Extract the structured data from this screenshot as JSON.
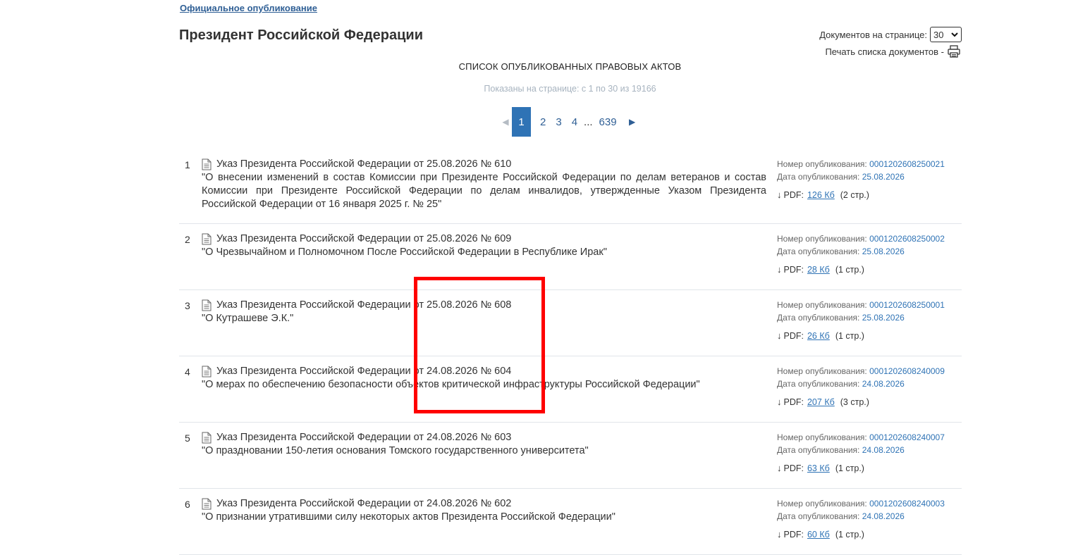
{
  "breadcrumb": "Официальное опубликование",
  "page_title": "Президент Российской Федерации",
  "per_page": {
    "label": "Документов на странице:",
    "value": "30"
  },
  "print_label": "Печать списка документов -",
  "list_heading": "СПИСОК ОПУБЛИКОВАННЫХ ПРАВОВЫХ АКТОВ",
  "shown_info": "Показаны на странице: с 1 по 30 из 19166",
  "pager": {
    "current": "1",
    "pages": [
      "2",
      "3",
      "4"
    ],
    "dots": "...",
    "last": "639"
  },
  "meta_labels": {
    "number": "Номер опубликования:",
    "date": "Дата опубликования:",
    "pdf": "PDF:"
  },
  "documents": [
    {
      "num": "1",
      "title": "Указ Президента Российской Федерации от 25.08.2026 № 610",
      "description": "\"О внесении изменений в состав Комиссии при Президенте Российской Федерации по делам ветеранов и состав Комиссии при Президенте Российской Федерации по делам инвалидов, утвержденные Указом Президента Российской Федерации от 16 января 2025 г. № 25\"",
      "pub_number": "0001202608250021",
      "pub_date": "25.08.2026",
      "pdf_size": "126 Кб",
      "pages": "(2 стр.)"
    },
    {
      "num": "2",
      "title": "Указ Президента Российской Федерации от 25.08.2026 № 609",
      "description": "\"О Чрезвычайном и Полномочном После Российской Федерации в Республике Ирак\"",
      "pub_number": "0001202608250002",
      "pub_date": "25.08.2026",
      "pdf_size": "28 Кб",
      "pages": "(1 стр.)"
    },
    {
      "num": "3",
      "title": "Указ Президента Российской Федерации от 25.08.2026 № 608",
      "description": "\"О Кутрашеве Э.К.\"",
      "pub_number": "0001202608250001",
      "pub_date": "25.08.2026",
      "pdf_size": "26 Кб",
      "pages": "(1 стр.)"
    },
    {
      "num": "4",
      "title": "Указ Президента Российской Федерации от 24.08.2026 № 604",
      "description": "\"О мерах по обеспечению безопасности объектов критической инфраструктуры Российской Федерации\"",
      "pub_number": "0001202608240009",
      "pub_date": "24.08.2026",
      "pdf_size": "207 Кб",
      "pages": "(3 стр.)"
    },
    {
      "num": "5",
      "title": "Указ Президента Российской Федерации от 24.08.2026 № 603",
      "description": "\"О праздновании 150-летия основания Томского государственного университета\"",
      "pub_number": "0001202608240007",
      "pub_date": "24.08.2026",
      "pdf_size": "63 Кб",
      "pages": "(1 стр.)"
    },
    {
      "num": "6",
      "title": "Указ Президента Российской Федерации от 24.08.2026 № 602",
      "description": "\"О признании утратившими силу некоторых актов Президента Российской Федерации\"",
      "pub_number": "0001202608240003",
      "pub_date": "24.08.2026",
      "pdf_size": "60 Кб",
      "pages": "(1 стр.)"
    }
  ],
  "colors": {
    "link": "#2f73b5",
    "pager_active": "#2f73b5",
    "highlight": "#ff0000"
  }
}
